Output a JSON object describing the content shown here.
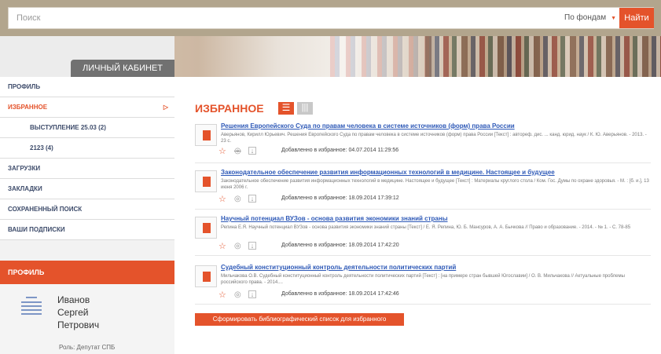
{
  "search": {
    "placeholder": "Поиск",
    "scope_label": "По фондам",
    "button_label": "Найти"
  },
  "cabinet": {
    "tab_label": "ЛИЧНЫЙ КАБИНЕТ"
  },
  "sidebar": {
    "items": [
      {
        "label": "ПРОФИЛЬ"
      },
      {
        "label": "ИЗБРАННОЕ"
      },
      {
        "label": "ВЫСТУПЛЕНИЕ 25.03 (2)"
      },
      {
        "label": "2123 (4)"
      },
      {
        "label": "ЗАГРУЗКИ"
      },
      {
        "label": "ЗАКЛАДКИ"
      },
      {
        "label": "СОХРАНЕННЫЙ ПОИСК"
      },
      {
        "label": "ВАШИ ПОДПИСКИ"
      }
    ],
    "active_arrow": "▷"
  },
  "profile": {
    "header": "ПРОФИЛЬ",
    "name_line1": "Иванов",
    "name_line2": "Сергей",
    "name_line3": "Петрович",
    "role": "Роль: Депутат СПБ"
  },
  "main": {
    "title": "ИЗБРАННОЕ",
    "view_list_icon": "☰",
    "view_grid_icon": "|||",
    "generate_button": "Сформировать библиографический список для избранного"
  },
  "entries": [
    {
      "title": "Решения Европейского Суда по правам человека в системе источников (форм) права России",
      "desc": "Аверьянов, Кирилл Юрьевич. Решения Европейского Суда по правам человека в системе источников (форм) права России [Текст] : автореф. дис. ... канд. юрид. наук / К. Ю. Аверьянов. - 2013. - 23 с.",
      "added": "Добавленно в избранное: 04.07.2014 11:29:56"
    },
    {
      "title": "Законодательное обеспечение развития информационных технологий в медицине. Настоящее и будущее",
      "desc": "Законодательное обеспечение развития информационных технологий в медицине. Настоящее и будущее [Текст] : Материалы круглого стола / Ком. Гос. Думы по охране здоровья. - М. : [б. и.], 13 июня 2006 г.",
      "added": "Добавленно в избранное: 18.09.2014 17:39:12"
    },
    {
      "title": "Научный потенциал ВУЗов - основа развития экономики знаний страны",
      "desc": "Репина Е.Я. Научный потенциал ВУЗов - основа развития экономики знаний страны [Текст] / Е. Я. Репина, Ю. Б. Мансуров, А. А. Бычкова // Право и образование. - 2014. - № 1. - С. 78-85",
      "added": "Добавленно в избранное: 18.09.2014 17:42:20"
    },
    {
      "title": "Судебный конституционный контроль деятельности политических партий",
      "desc": "Мильчакова О.В. Судебный конституционный контроль деятельности политических партий [Текст] : [на примере стран бывшей Югославии] / О. В. Мильчакова // Актуальные проблемы российского права. - 2014....",
      "added": "Добавленно в избранное: 18.09.2014 17:42:46"
    }
  ],
  "icons": {
    "favorite": "star-outline-icon",
    "view": "eye-icon",
    "download": "download-icon"
  },
  "colors": {
    "accent": "#e4532b",
    "link": "#2e59b7",
    "topbar": "#b2a58d"
  }
}
